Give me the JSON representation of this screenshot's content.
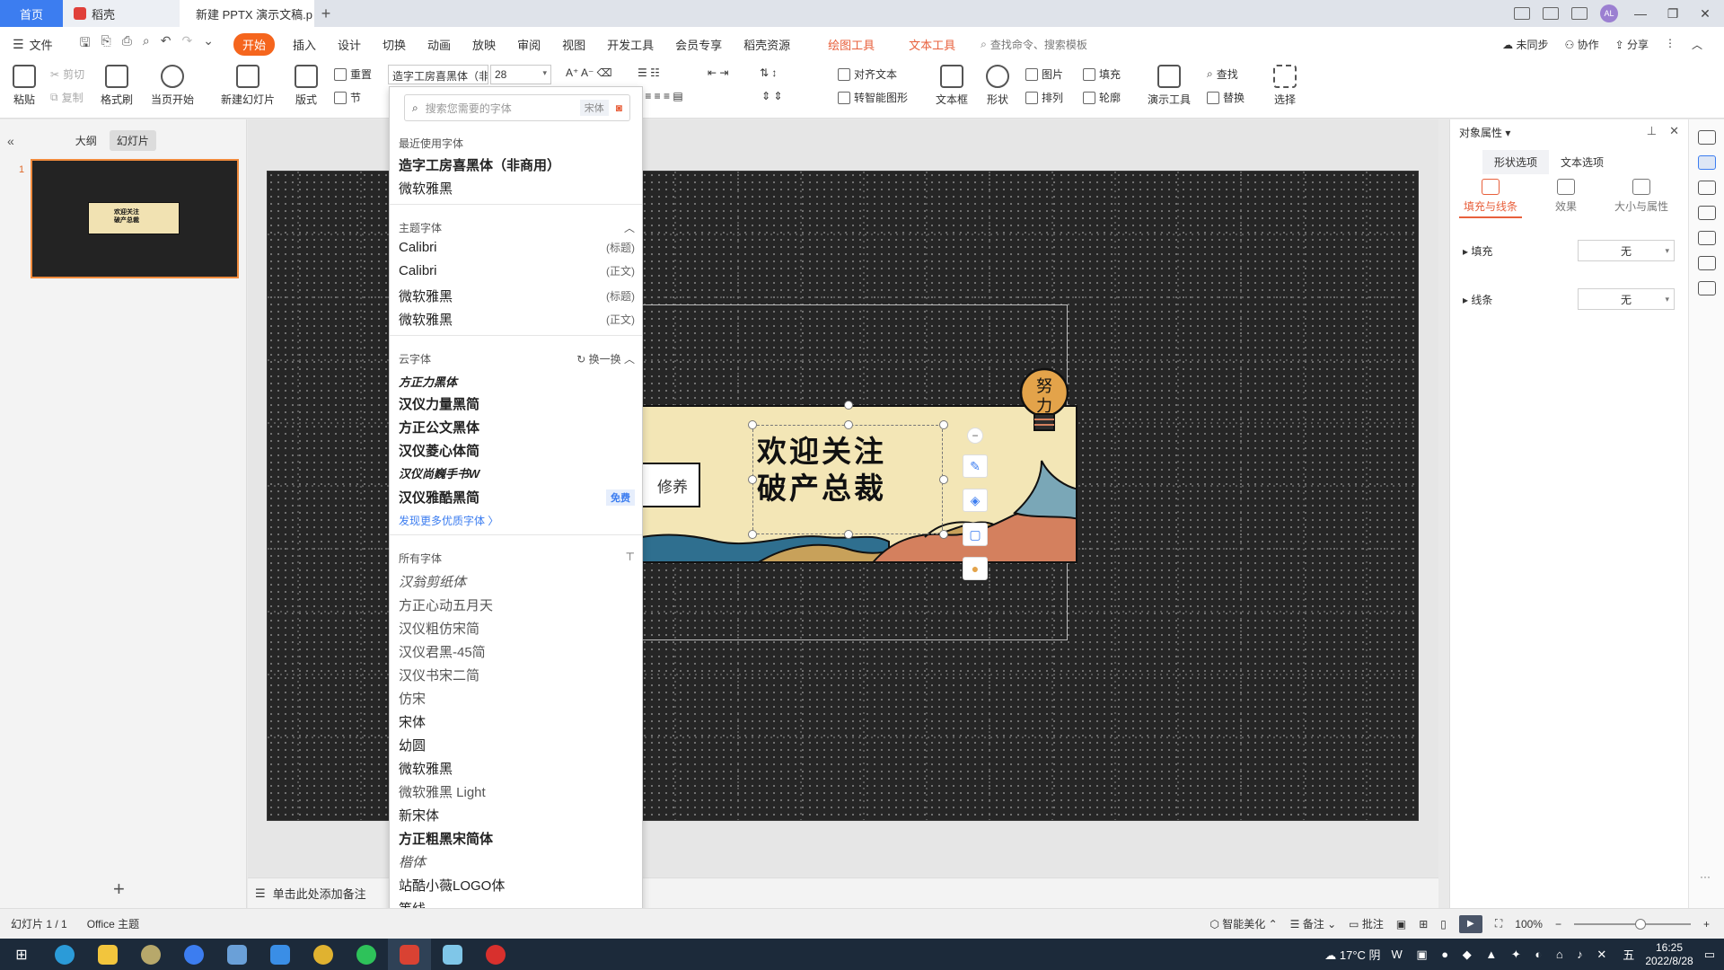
{
  "tabs": [
    {
      "label": "首页"
    },
    {
      "label": "稻壳"
    },
    {
      "label": "新建 PPTX 演示文稿.p"
    }
  ],
  "menu": {
    "file": "文件",
    "items": [
      "开始",
      "插入",
      "设计",
      "切换",
      "动画",
      "放映",
      "审阅",
      "视图",
      "开发工具",
      "会员专享",
      "稻壳资源"
    ],
    "context": [
      "绘图工具",
      "文本工具"
    ],
    "search": "查找命令、搜索模板",
    "right": [
      "未同步",
      "协作",
      "分享"
    ]
  },
  "ribbon": {
    "paste": "粘贴",
    "cut": "剪切",
    "copy": "复制",
    "format_painter": "格式刷",
    "from_current": "当页开始",
    "new_slide": "新建幻灯片",
    "layout": "版式",
    "reset": "重置",
    "section": "节",
    "font_name": "造字工房喜黑体（非",
    "font_size": "28",
    "align_text": "对齐文本",
    "smart_shape": "转智能图形",
    "textbox": "文本框",
    "shape": "形状",
    "picture": "图片",
    "fill": "填充",
    "arrange": "排列",
    "outline": "轮廓",
    "presentation_tools": "演示工具",
    "find": "查找",
    "replace": "替换",
    "select": "选择"
  },
  "left_pane": {
    "tab_outline": "大纲",
    "tab_slides": "幻灯片",
    "slide_number": "1",
    "thumb_text": "欢迎关注\n破产总裁"
  },
  "slide": {
    "title_line1": "欢迎关注",
    "title_line2": "破产总裁",
    "sign_text": "修养",
    "bulb_text": "努\n力"
  },
  "notes_placeholder": "单击此处添加备注",
  "font_dropdown": {
    "search_placeholder": "搜索您需要的字体",
    "search_tag": "宋体",
    "recent_header": "最近使用字体",
    "recent": [
      "造字工房喜黑体（非商用）",
      "微软雅黑"
    ],
    "theme_header": "主题字体",
    "theme": [
      {
        "name": "Calibri",
        "note": "(标题)"
      },
      {
        "name": "Calibri",
        "note": "(正文)"
      },
      {
        "name": "微软雅黑",
        "note": "(标题)"
      },
      {
        "name": "微软雅黑",
        "note": "(正文)"
      }
    ],
    "cloud_header": "云字体",
    "cloud_refresh": "换一换",
    "cloud": [
      "方正力黑体",
      "汉仪力量黑简",
      "方正公文黑体",
      "汉仪菱心体简",
      "汉仪尚巍手书W",
      "汉仪雅酷黑简"
    ],
    "cloud_free": "免费",
    "more_link": "发现更多优质字体 〉",
    "all_header": "所有字体",
    "all": [
      "汉翁剪纸体",
      "方正心动五月天",
      "汉仪粗仿宋简",
      "汉仪君黑-45简",
      "汉仪书宋二简",
      "仿宋",
      "宋体",
      "幼圆",
      "微软雅黑",
      "微软雅黑 Light",
      "新宋体",
      "方正粗黑宋简体",
      "楷体",
      "站酷小薇LOGO体",
      "等线"
    ]
  },
  "right_panel": {
    "title": "对象属性",
    "tab_shape": "形状选项",
    "tab_text": "文本选项",
    "sub_fill_line": "填充与线条",
    "sub_effect": "效果",
    "sub_size": "大小与属性",
    "fill_label": "填充",
    "fill_value": "无",
    "line_label": "线条",
    "line_value": "无"
  },
  "status": {
    "slide_info": "幻灯片 1 / 1",
    "theme": "Office 主题",
    "beautify": "智能美化",
    "notes": "备注",
    "comment": "批注",
    "zoom": "100%"
  },
  "taskbar": {
    "weather": "17°C 阴",
    "ime": "五",
    "time": "16:25",
    "date": "2022/8/28"
  },
  "colors": {
    "accent": "#f5651d",
    "home_tab": "#3c7df0",
    "banner_bg": "#f3e6b6",
    "slide_bg": "#262626"
  }
}
